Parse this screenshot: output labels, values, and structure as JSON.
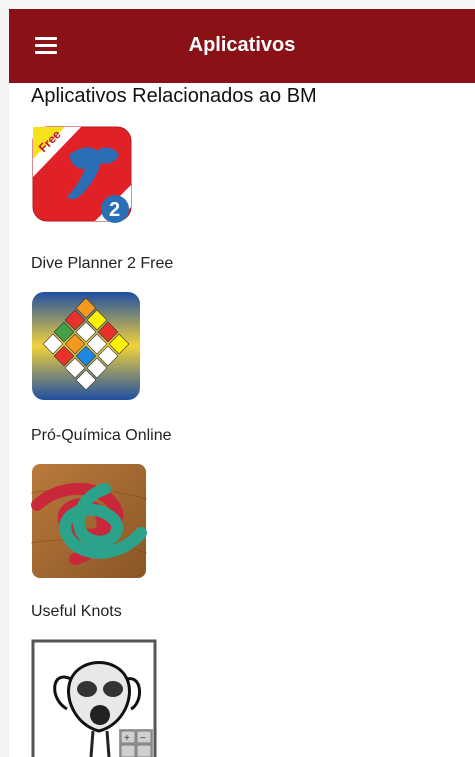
{
  "app_bar": {
    "title": "Aplicativos",
    "menu_icon": "hamburger-menu-icon"
  },
  "section": {
    "heading": "Aplicativos Relacionados ao BM"
  },
  "apps": [
    {
      "name": "Dive Planner 2 Free",
      "icon": "dive-flag-icon",
      "badge": "Free",
      "badge_number": "2"
    },
    {
      "name": "Pró-Química Online",
      "icon": "hazmat-placards-icon"
    },
    {
      "name": "Useful Knots",
      "icon": "knot-icon"
    },
    {
      "name": "",
      "icon": "gas-mask-icon",
      "zoom_plus": "+",
      "zoom_minus": "−"
    }
  ],
  "colors": {
    "appbar": "#8a1116",
    "dive_red": "#e02128",
    "free_badge": "#f5e21b"
  }
}
